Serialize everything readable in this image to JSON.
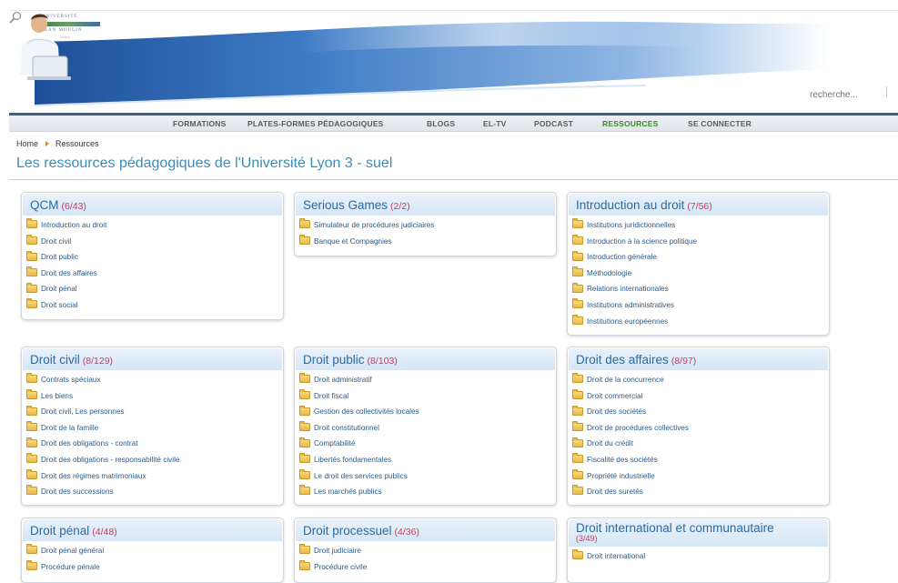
{
  "header": {
    "logo_line1": "UNIVERSITÉ",
    "logo_line2": "JEAN MOULIN",
    "logo_line3": "LYON 3",
    "search_placeholder": "recherche..."
  },
  "nav": {
    "items": [
      {
        "label": "FORMATIONS",
        "active": false
      },
      {
        "label": "PLATES-FORMES PÉDAGOGIQUES",
        "active": false
      },
      {
        "label": "BLOGS",
        "active": false
      },
      {
        "label": "EL-TV",
        "active": false
      },
      {
        "label": "PODCAST",
        "active": false
      },
      {
        "label": "RESSOURCES",
        "active": true
      },
      {
        "label": "SE CONNECTER",
        "active": false
      }
    ]
  },
  "breadcrumb": {
    "home": "Home",
    "current": "Ressources"
  },
  "page_title": "Les ressources pédagogiques de l'Université Lyon 3 - suel",
  "boxes": [
    {
      "title": "QCM",
      "count": "(6/43)",
      "items": [
        "Introduction au droit",
        "Droit civil",
        "Droit public",
        "Droit des affaires",
        "Droit pénal",
        "Droit social"
      ]
    },
    {
      "title": "Serious Games",
      "count": "(2/2)",
      "items": [
        "Simulateur de procédures judiciaires",
        "Banque et Compagnies"
      ]
    },
    {
      "title": "Introduction au droit",
      "count": "(7/56)",
      "items": [
        "Institutions juridictionnelles",
        "Introduction à la science politique",
        "Introduction générale",
        "Méthodologie",
        "Relations internationales",
        "Institutions administratives",
        "Institutions européennes"
      ]
    },
    {
      "title": "Droit civil",
      "count": "(8/129)",
      "items": [
        "Contrats spéciaux",
        "Les biens",
        "Droit civil, Les personnes",
        "Droit de la famille",
        "Droit des obligations - contrat",
        "Droit des obligations - responsabilité civile",
        "Droit des régimes matrimoniaux",
        "Droit des successions"
      ]
    },
    {
      "title": "Droit public",
      "count": "(8/103)",
      "items": [
        "Droit administratif",
        "Droit fiscal",
        "Gestion des collectivités locales",
        "Droit constitutionnel",
        "Comptabilité",
        "Libertés fondamentales",
        "Le droit des services publics",
        "Les marchés publics"
      ]
    },
    {
      "title": "Droit des affaires",
      "count": "(8/97)",
      "items": [
        "Droit de la concurrence",
        "Droit commercial",
        "Droit des sociétés",
        "Droit de procédures collectives",
        "Droit du crédit",
        "Fiscalité des sociétés",
        "Propriété industrielle",
        "Droit des suretés"
      ]
    },
    {
      "title": "Droit pénal",
      "count": "(4/48)",
      "items": [
        "Droit pénal général",
        "Procédure pénale"
      ]
    },
    {
      "title": "Droit processuel",
      "count": "(4/36)",
      "items": [
        "Droit judiciaire",
        "Procédure civile"
      ]
    },
    {
      "title": "Droit international et communautaire",
      "count": "(3/49)",
      "items": [
        "Droit international"
      ]
    }
  ]
}
